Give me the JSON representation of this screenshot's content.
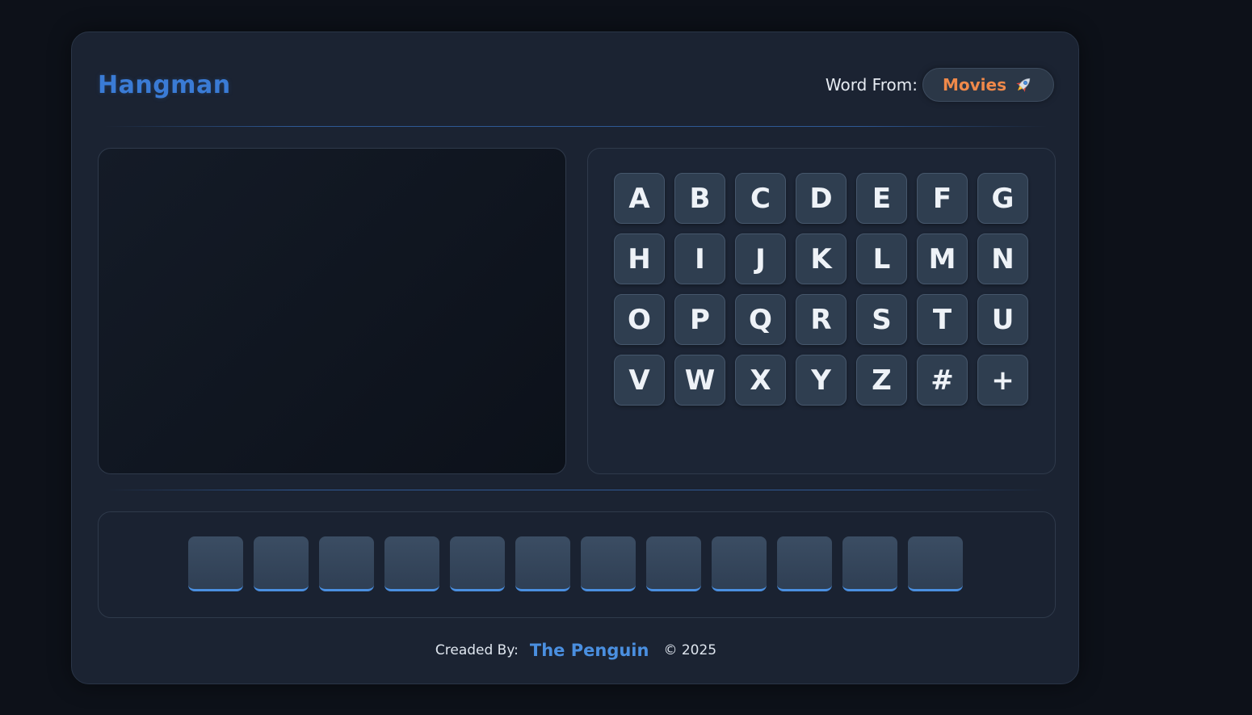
{
  "header": {
    "title": "Hangman",
    "category_label": "Word From:",
    "category_value": "Movies",
    "category_icon": "rocket-icon"
  },
  "keyboard": {
    "keys": [
      "A",
      "B",
      "C",
      "D",
      "E",
      "F",
      "G",
      "H",
      "I",
      "J",
      "K",
      "L",
      "M",
      "N",
      "O",
      "P",
      "Q",
      "R",
      "S",
      "T",
      "U",
      "V",
      "W",
      "X",
      "Y",
      "Z",
      "#",
      "+"
    ]
  },
  "word": {
    "letter_count": 12,
    "letters": [
      "",
      "",
      "",
      "",
      "",
      "",
      "",
      "",
      "",
      "",
      "",
      ""
    ]
  },
  "footer": {
    "label": "Creaded By:",
    "author": "The Penguin",
    "copyright": "© 2025"
  },
  "colors": {
    "background": "#0d1119",
    "card": "#1b2332",
    "accent_blue": "#3a7bd5",
    "category_orange": "#f0894a",
    "key_bg": "#2f3e50"
  }
}
